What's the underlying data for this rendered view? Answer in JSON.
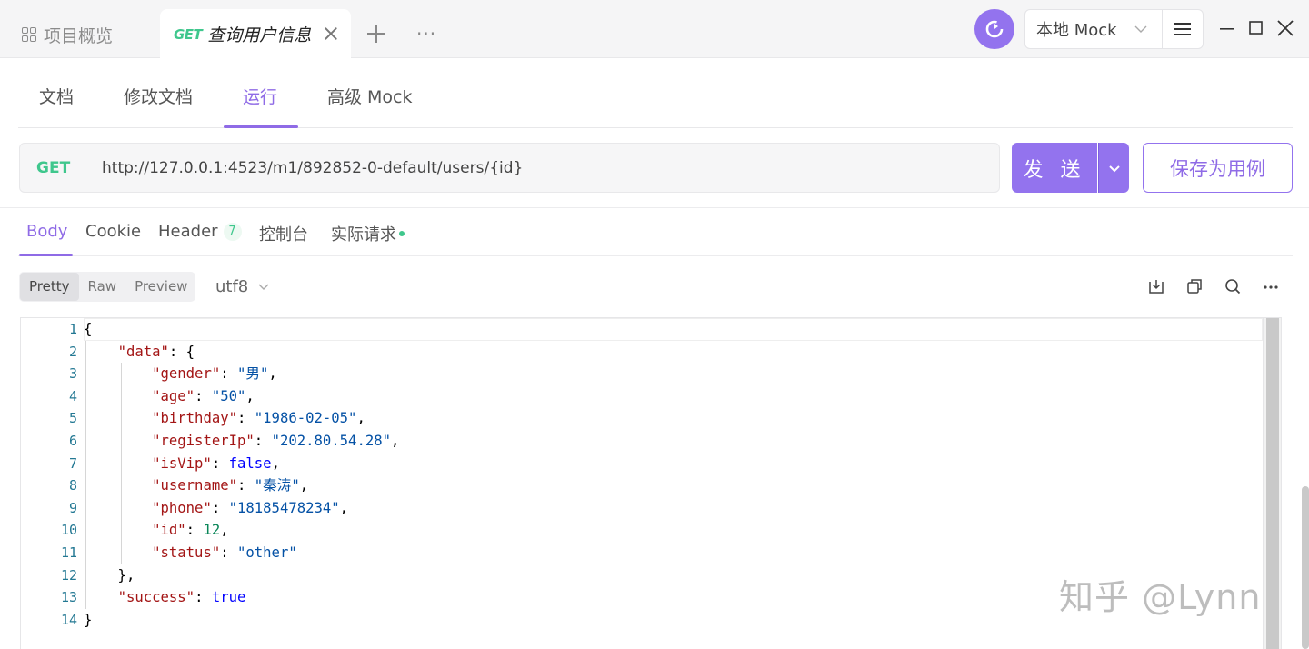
{
  "topbar": {
    "overview_tab": "项目概览",
    "active_tab": {
      "method": "GET",
      "title": "查询用户信息"
    },
    "environment": "本地 Mock"
  },
  "sub_tabs": [
    "文档",
    "修改文档",
    "运行",
    "高级 Mock"
  ],
  "active_sub_tab": "运行",
  "request": {
    "method": "GET",
    "url": "http://127.0.0.1:4523/m1/892852-0-default/users/{id}",
    "send_label": "发 送",
    "save_label": "保存为用例"
  },
  "response_tabs": {
    "body": "Body",
    "cookie": "Cookie",
    "header": "Header",
    "header_count": "7",
    "console": "控制台",
    "actual_request": "实际请求"
  },
  "view_modes": [
    "Pretty",
    "Raw",
    "Preview"
  ],
  "active_view_mode": "Pretty",
  "encoding": "utf8",
  "code": {
    "line_numbers": [
      "1",
      "2",
      "3",
      "4",
      "5",
      "6",
      "7",
      "8",
      "9",
      "10",
      "11",
      "12",
      "13",
      "14"
    ],
    "data_key": "\"data\"",
    "fields": [
      {
        "key": "\"gender\"",
        "value": "\"男\"",
        "type": "string"
      },
      {
        "key": "\"age\"",
        "value": "\"50\"",
        "type": "string"
      },
      {
        "key": "\"birthday\"",
        "value": "\"1986-02-05\"",
        "type": "string"
      },
      {
        "key": "\"registerIp\"",
        "value": "\"202.80.54.28\"",
        "type": "string"
      },
      {
        "key": "\"isVip\"",
        "value": "false",
        "type": "bool"
      },
      {
        "key": "\"username\"",
        "value": "\"秦涛\"",
        "type": "string"
      },
      {
        "key": "\"phone\"",
        "value": "\"18185478234\"",
        "type": "string"
      },
      {
        "key": "\"id\"",
        "value": "12",
        "type": "number"
      },
      {
        "key": "\"status\"",
        "value": "\"other\"",
        "type": "string"
      }
    ],
    "success_key": "\"success\"",
    "success_value": "true"
  },
  "watermark": "知乎 @Lynn",
  "colors": {
    "accent": "#9373ee",
    "method_get": "#3fc78d"
  }
}
